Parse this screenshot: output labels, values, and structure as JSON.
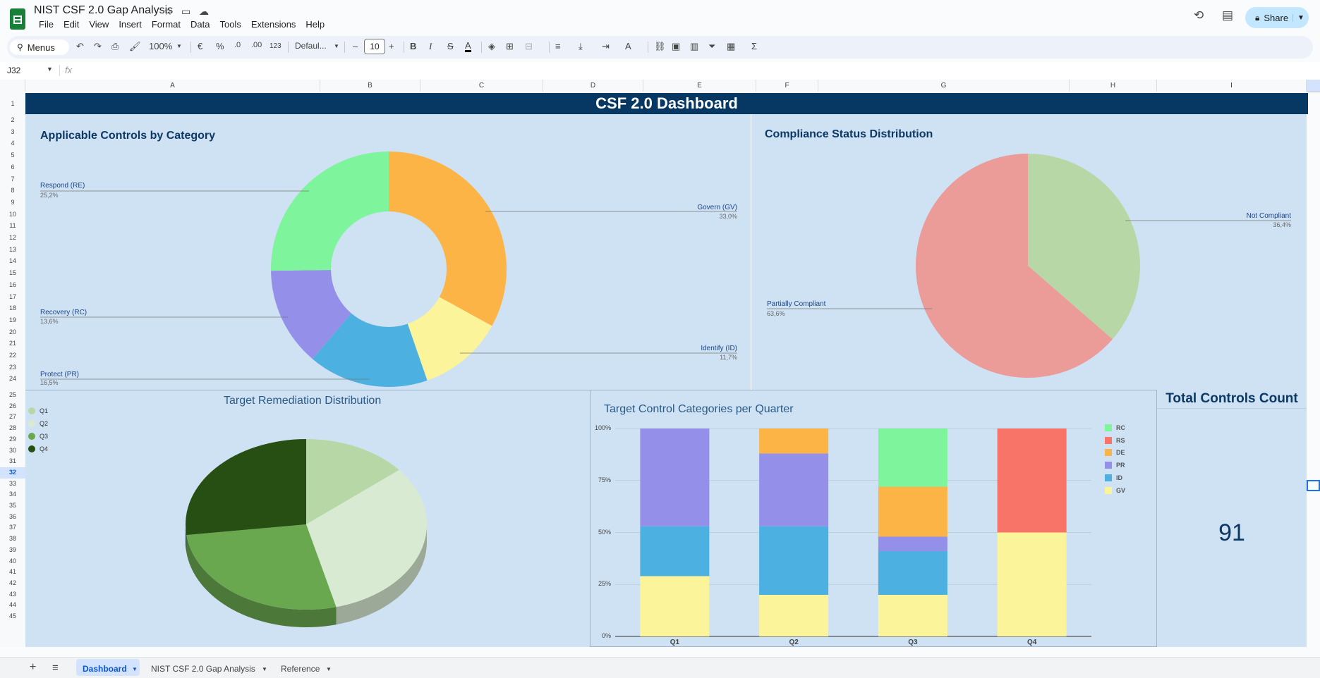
{
  "app": {
    "title": "NIST CSF 2.0 Gap Analysis",
    "menu": [
      "File",
      "Edit",
      "View",
      "Insert",
      "Format",
      "Data",
      "Tools",
      "Extensions",
      "Help"
    ],
    "share_label": "Share"
  },
  "toolbar": {
    "search_label": "Menus",
    "zoom": "100%",
    "currency": "€",
    "percent": "%",
    "dec_decrease": ".0",
    "dec_increase": ".00",
    "number_format": "123",
    "font": "Defaul...",
    "font_size": "10",
    "minus": "–",
    "plus": "+",
    "bold": "B",
    "italic": "I",
    "strike": "S",
    "text_color": "A",
    "text_rotate": "A",
    "sum": "Σ"
  },
  "formula_bar": {
    "cell_ref": "J32",
    "fx": "fx"
  },
  "columns": [
    "A",
    "B",
    "C",
    "D",
    "E",
    "F",
    "G",
    "H",
    "I"
  ],
  "rows": [
    "1",
    "2",
    "3",
    "4",
    "5",
    "6",
    "7",
    "8",
    "9",
    "10",
    "11",
    "12",
    "13",
    "14",
    "15",
    "16",
    "17",
    "18",
    "19",
    "20",
    "21",
    "22",
    "23",
    "24",
    "25",
    "26",
    "27",
    "28",
    "29",
    "30",
    "31",
    "32",
    "33",
    "34",
    "35",
    "36",
    "37",
    "38",
    "39",
    "40",
    "41",
    "42",
    "43",
    "44",
    "45"
  ],
  "dashboard": {
    "header": "CSF 2.0 Dashboard",
    "total_title": "Total Controls Count",
    "total_value": "91"
  },
  "colors": {
    "header": "#073763",
    "panel": "#cfe2f3",
    "GV": "#fbf49a",
    "ID": "#4cb0e0",
    "PR": "#9490ea",
    "DE": "#fbb445",
    "RS": "#f87468",
    "RC": "#7ef59c"
  },
  "chart_data": [
    {
      "type": "pie",
      "title": "Applicable Controls by Category",
      "labels": [
        "Govern (GV)",
        "Identify (ID)",
        "Protect (PR)",
        "Recovery (RC)",
        "Respond (RE)"
      ],
      "values": [
        33.0,
        11.7,
        16.5,
        13.6,
        25.2
      ],
      "value_labels": [
        "33,0%",
        "11,7%",
        "16,5%",
        "13,6%",
        "25,2%"
      ],
      "colors": [
        "#fbb445",
        "#fbf49a",
        "#4cb0e0",
        "#9490ea",
        "#7ef59c"
      ],
      "donut": true
    },
    {
      "type": "pie",
      "title": "Compliance Status Distribution",
      "labels": [
        "Not Compliant",
        "Partially Compliant"
      ],
      "values": [
        36.4,
        63.6
      ],
      "value_labels": [
        "36,4%",
        "63,6%"
      ],
      "colors": [
        "#b7d8a6",
        "#eb9b98"
      ]
    },
    {
      "type": "pie",
      "title": "Target Remediation Distribution",
      "labels": [
        "Q1",
        "Q2",
        "Q3",
        "Q4"
      ],
      "values": [
        14,
        32,
        27,
        27
      ],
      "colors": [
        "#b7d8a6",
        "#d9ead3",
        "#6aa84f",
        "#274e13"
      ],
      "legend": "left"
    },
    {
      "type": "bar",
      "stacked": "percent",
      "title": "Target Control Categories per Quarter",
      "categories": [
        "Q1",
        "Q2",
        "Q3",
        "Q4"
      ],
      "yticks": [
        "0%",
        "25%",
        "50%",
        "75%",
        "100%"
      ],
      "legend": "right",
      "series": [
        {
          "name": "GV",
          "color": "#fbf49a",
          "values": [
            29,
            20,
            20,
            50
          ]
        },
        {
          "name": "ID",
          "color": "#4cb0e0",
          "values": [
            24,
            33,
            21,
            0
          ]
        },
        {
          "name": "PR",
          "color": "#9490ea",
          "values": [
            47,
            35,
            7,
            0
          ]
        },
        {
          "name": "DE",
          "color": "#fbb445",
          "values": [
            0,
            12,
            24,
            0
          ]
        },
        {
          "name": "RS",
          "color": "#f87468",
          "values": [
            0,
            0,
            0,
            50
          ]
        },
        {
          "name": "RC",
          "color": "#7ef59c",
          "values": [
            0,
            0,
            28,
            0
          ]
        }
      ]
    }
  ],
  "tabs": [
    "Dashboard",
    "NIST CSF 2.0 Gap Analysis",
    "Reference"
  ]
}
